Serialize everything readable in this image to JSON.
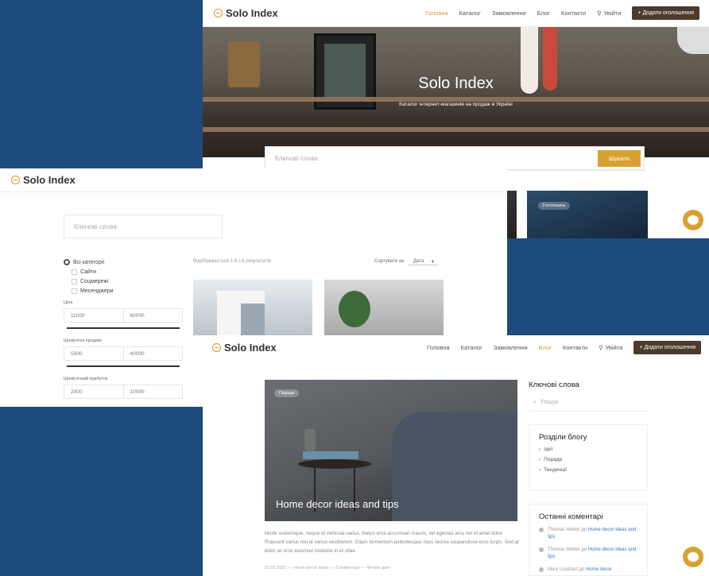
{
  "colors": {
    "background": "#1f4a7c",
    "accent": "#d7a232",
    "cta": "#4a3b2c",
    "link": "#3a75b5"
  },
  "brand": "Solo Index",
  "nav": {
    "items": [
      "Головна",
      "Каталог",
      "Замовлення",
      "Блог",
      "Контакти"
    ],
    "login": "Увійти",
    "cta": "Додати оголошення"
  },
  "home": {
    "hero_title": "Solo Index",
    "hero_subtitle": "Каталог інтернет-магазинів на продаж в Україні",
    "search_placeholder": "Ключові слова",
    "search_button": "Шукати",
    "card_badge": "З оголошень"
  },
  "catalog": {
    "search_placeholder": "Ключові слова",
    "categories": {
      "all": "Всі категорії",
      "items": [
        "Сайти",
        "Соцмережі",
        "Месенджери"
      ]
    },
    "filters": [
      {
        "label": "Ціна",
        "min": "11000",
        "max": "60000"
      },
      {
        "label": "Щомісячні продажі",
        "min": "5000",
        "max": "40000"
      },
      {
        "label": "Щомісячний прибуток",
        "min": "2000",
        "max": "10000"
      }
    ],
    "results_text": "Відображається 1-6 з 6 результатів",
    "sort_label": "Сортувати за",
    "sort_value": "Дата"
  },
  "blog": {
    "featured_tag": "Поради",
    "featured_title": "Home decor ideas and tips",
    "excerpt": "Morbi scelerisque, neque ut vehicula varius, metus eros accumsan mauris, vel egestas arcu leo id amet dolor. Praesent varius nisl at varius vestibulum. Etiam fermentum pellentesque risus lacinia suspendisse eros turpis. Sed at dolor ac eros euismod molestie in et vitae.",
    "meta": "21.02.2021 — Home decor ideas — 2 коментарі — Читати далі",
    "sidebar": {
      "keywords_title": "Ключові слова",
      "search_placeholder": "Пошук",
      "sections_title": "Розділи блогу",
      "sections": [
        "Ідеї",
        "Поради",
        "Тенденції"
      ],
      "comments_title": "Останні коментарі",
      "comments": [
        {
          "author": "Thomas Hebbs",
          "on": "до",
          "post": "Home decor ideas and tips"
        },
        {
          "author": "Thomas Hebbs",
          "on": "до",
          "post": "Home decor ideas and tips"
        },
        {
          "author": "Mary Lockhart",
          "on": "до",
          "post": "Home decor"
        }
      ]
    }
  }
}
